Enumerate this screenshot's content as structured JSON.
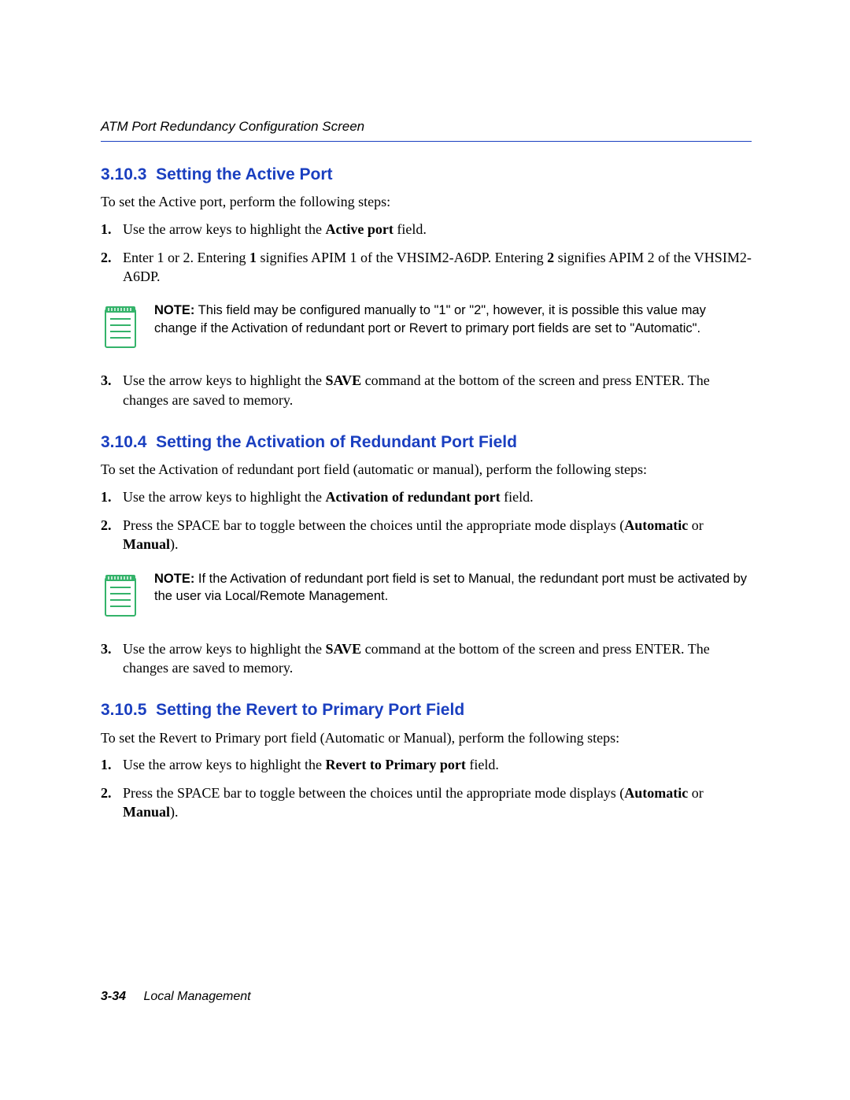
{
  "header": {
    "running_title": "ATM Port Redundancy Configuration Screen"
  },
  "sections": {
    "s1": {
      "number": "3.10.3",
      "title": "Setting the Active Port",
      "intro": "To set the Active port, perform the following steps:",
      "steps": {
        "n1": "1.",
        "t1a": "Use the arrow keys to highlight the ",
        "t1b": "Active port",
        "t1c": " field.",
        "n2": "2.",
        "t2a": "Enter 1 or 2. Entering ",
        "t2b": "1",
        "t2c": " signifies APIM 1 of the VHSIM2-A6DP. Entering ",
        "t2d": "2",
        "t2e": " signifies APIM 2 of the VHSIM2-A6DP.",
        "n3": "3.",
        "t3a": "Use the arrow keys to highlight the ",
        "t3b": "SAVE",
        "t3c": " command at the bottom of the screen and press ENTER. The changes are saved to memory."
      },
      "note": {
        "label": "NOTE:",
        "text": "  This field may be configured manually to \"1\" or \"2\", however, it is possible this value may change if the Activation of redundant port or Revert to primary port fields are set to \"Automatic\"."
      }
    },
    "s2": {
      "number": "3.10.4",
      "title": "Setting the Activation of Redundant Port Field",
      "intro": "To set the Activation of redundant port field (automatic or manual), perform the following steps:",
      "steps": {
        "n1": "1.",
        "t1a": "Use the arrow keys to highlight the ",
        "t1b": "Activation of redundant port",
        "t1c": " field.",
        "n2": "2.",
        "t2a": "Press the SPACE bar to toggle between the choices until the appropriate mode displays (",
        "t2b": "Automatic",
        "t2c": " or ",
        "t2d": "Manual",
        "t2e": ").",
        "n3": "3.",
        "t3a": "Use the arrow keys to highlight the ",
        "t3b": "SAVE",
        "t3c": " command at the bottom of the screen and press ENTER. The changes are saved to memory."
      },
      "note": {
        "label": "NOTE:",
        "text": "  If the Activation of redundant port field is set to Manual, the redundant port must be activated by the user via Local/Remote Management."
      }
    },
    "s3": {
      "number": "3.10.5",
      "title": "Setting the Revert to Primary Port Field",
      "intro": "To set the Revert to Primary port field (Automatic or Manual), perform the following steps:",
      "steps": {
        "n1": "1.",
        "t1a": "Use the arrow keys to highlight the ",
        "t1b": "Revert to Primary port",
        "t1c": " field.",
        "n2": "2.",
        "t2a": "Press the SPACE bar to toggle between the choices until the appropriate mode displays (",
        "t2b": "Automatic",
        "t2c": " or ",
        "t2d": "Manual",
        "t2e": ")."
      }
    }
  },
  "footer": {
    "page": "3-34",
    "chapter": "Local Management"
  }
}
